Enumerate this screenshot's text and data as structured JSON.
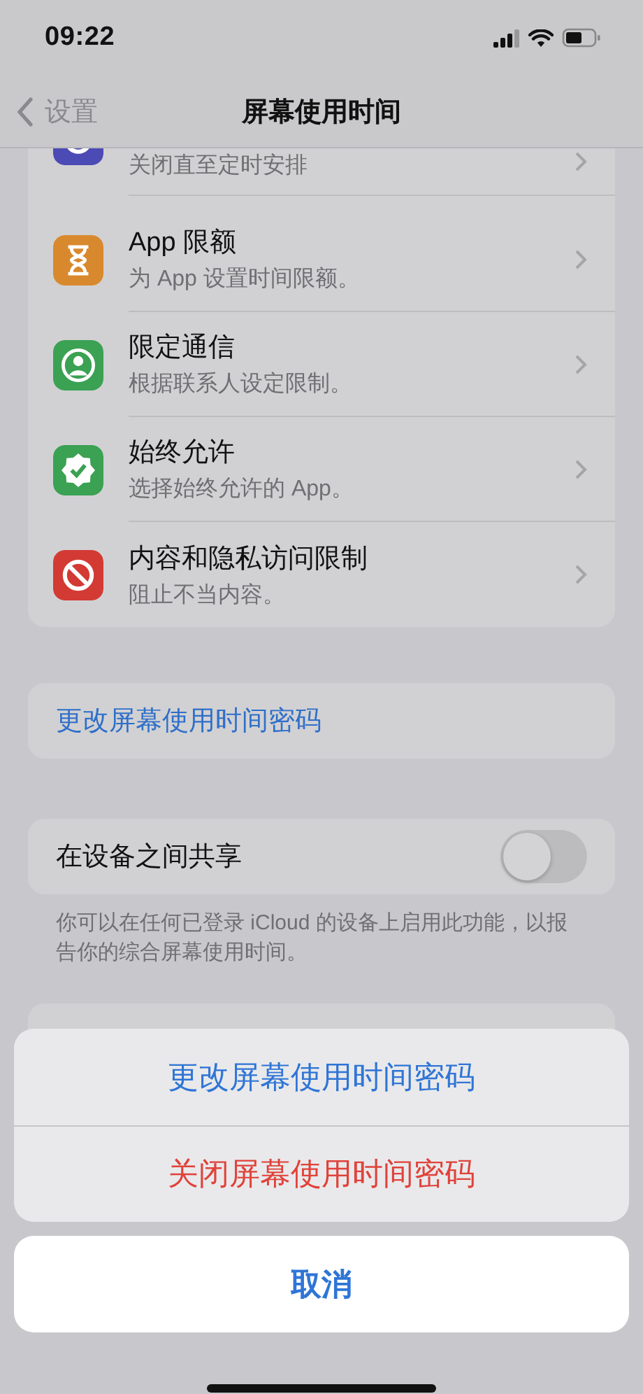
{
  "status_bar": {
    "time": "09:22"
  },
  "nav": {
    "back": "设置",
    "title": "屏幕使用时间"
  },
  "features": [
    {
      "kind": "downtime",
      "subtitle": "关闭直至定时安排"
    },
    {
      "kind": "app-limits",
      "title": "App 限额",
      "subtitle": "为 App 设置时间限额。"
    },
    {
      "kind": "communication",
      "title": "限定通信",
      "subtitle": "根据联系人设定限制。"
    },
    {
      "kind": "always-allowed",
      "title": "始终允许",
      "subtitle": "选择始终允许的 App。"
    },
    {
      "kind": "restrictions",
      "title": "内容和隐私访问限制",
      "subtitle": "阻止不当内容。"
    }
  ],
  "passcode_link": "更改屏幕使用时间密码",
  "share": {
    "label": "在设备之间共享",
    "on": false,
    "footnote": "你可以在任何已登录 iCloud 的设备上启用此功能，以报告你的综合屏幕使用时间。"
  },
  "action_sheet": {
    "actions": [
      {
        "kind": "default",
        "label": "更改屏幕使用时间密码"
      },
      {
        "kind": "destructive",
        "label": "关闭屏幕使用时间密码"
      }
    ],
    "cancel": "取消"
  }
}
